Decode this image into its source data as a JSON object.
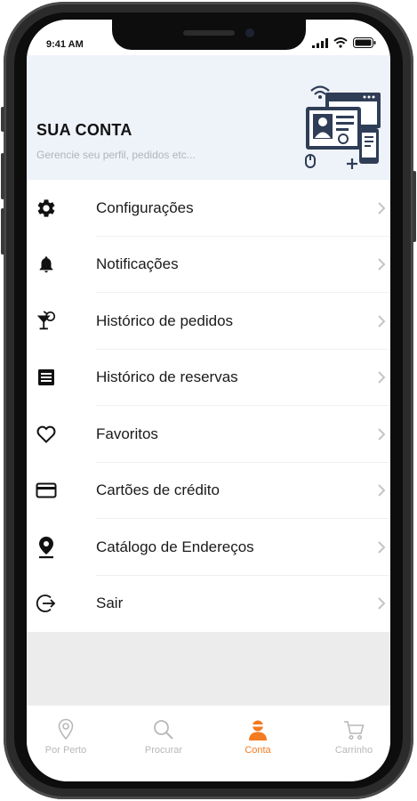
{
  "status_bar": {
    "time": "9:41 AM"
  },
  "header": {
    "title": "SUA CONTA",
    "subtitle": "Gerencie seu perfil, pedidos etc..."
  },
  "menu": {
    "items": [
      {
        "label": "Configurações",
        "icon": "gear-icon"
      },
      {
        "label": "Notificações",
        "icon": "bell-icon"
      },
      {
        "label": "Histórico de pedidos",
        "icon": "cocktail-icon"
      },
      {
        "label": "Histórico de reservas",
        "icon": "list-document-icon"
      },
      {
        "label": "Favoritos",
        "icon": "heart-icon"
      },
      {
        "label": "Cartões de crédito",
        "icon": "credit-card-icon"
      },
      {
        "label": "Catálogo de Endereços",
        "icon": "location-pin-icon"
      },
      {
        "label": "Sair",
        "icon": "logout-icon"
      }
    ]
  },
  "tabbar": {
    "tabs": [
      {
        "label": "Por Perto",
        "icon": "location-pin-icon",
        "active": false
      },
      {
        "label": "Procurar",
        "icon": "search-icon",
        "active": false
      },
      {
        "label": "Conta",
        "icon": "user-icon",
        "active": true
      },
      {
        "label": "Carrinho",
        "icon": "cart-icon",
        "active": false
      }
    ]
  },
  "colors": {
    "accent": "#f47b20",
    "header_bg": "#eef2f9",
    "illustration": "#2f3d56",
    "inactive_tab": "#b8b8b8"
  }
}
